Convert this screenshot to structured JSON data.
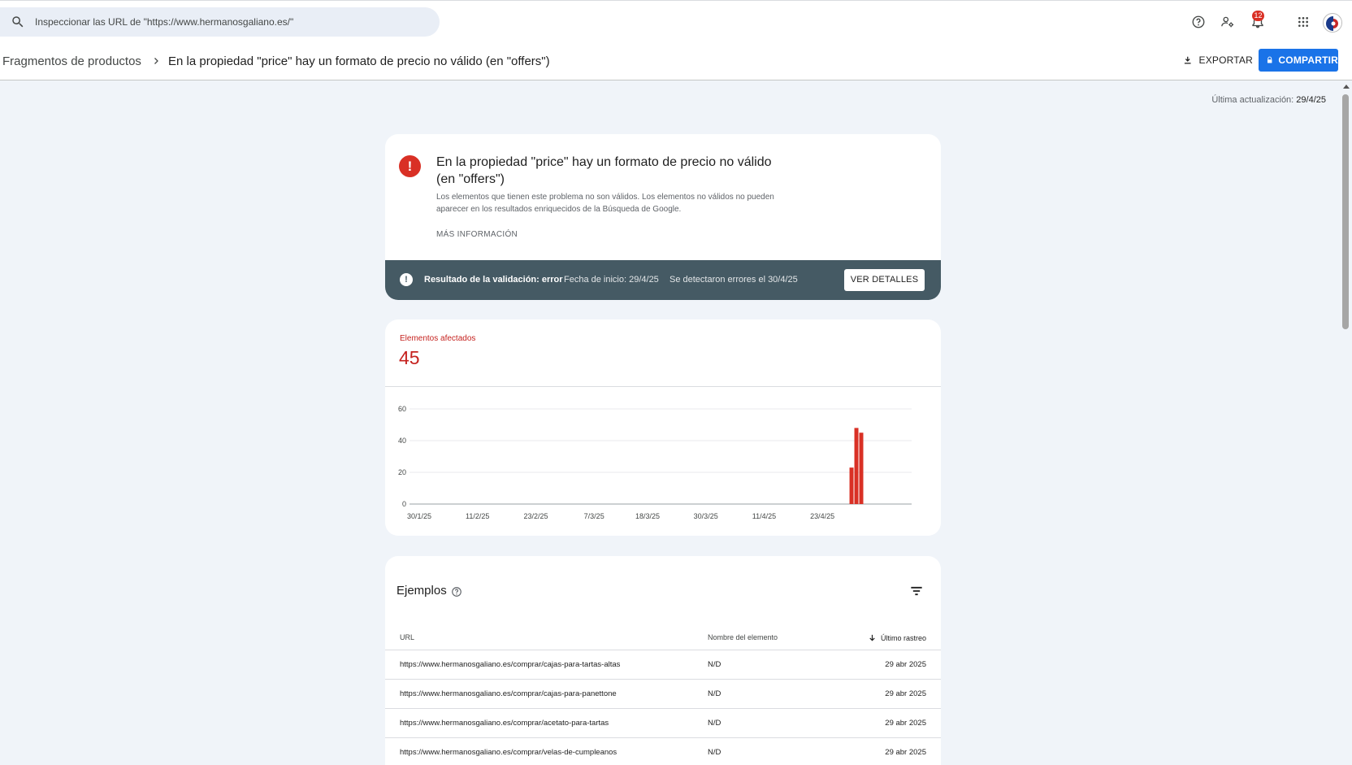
{
  "search": {
    "placeholder": "Inspeccionar las URL de \"https://www.hermanosgaliano.es/\""
  },
  "topbar": {
    "notifications_count": "12",
    "icons": [
      "help-icon",
      "manage-users-icon",
      "notifications-icon",
      "apps-icon",
      "account-avatar"
    ]
  },
  "header": {
    "breadcrumb": "Fragmentos de productos",
    "title": "En la propiedad \"price\" hay un formato de precio no válido (en \"offers\")",
    "export_label": "EXPORTAR",
    "share_label": "COMPARTIR"
  },
  "updated": {
    "label": "Última actualización:",
    "date": "29/4/25"
  },
  "issue": {
    "title": "En la propiedad \"price\" hay un formato de precio no válido (en \"offers\")",
    "description": "Los elementos que tienen este problema no son válidos. Los elementos no válidos no pueden aparecer en los resultados enriquecidos de la Búsqueda de Google.",
    "more_info": "MÁS INFORMACIÓN"
  },
  "validation": {
    "result": "Resultado de la validación: error",
    "start_date": "Fecha de inicio: 29/4/25",
    "errors_detected": "Se detectaron errores el 30/4/25",
    "details_button": "VER DETALLES"
  },
  "affected": {
    "label": "Elementos afectados",
    "count": "45"
  },
  "chart_data": {
    "type": "bar",
    "x_tick_labels": [
      "30/1/25",
      "11/2/25",
      "23/2/25",
      "7/3/25",
      "18/3/25",
      "30/3/25",
      "11/4/25",
      "23/4/25"
    ],
    "y_ticks": [
      0,
      20,
      40,
      60
    ],
    "ylim": [
      0,
      60
    ],
    "x_start": "30/1/25",
    "x_end": "30/4/25",
    "points": [
      {
        "x": "28/4/25",
        "y": 23
      },
      {
        "x": "29/4/25",
        "y": 48
      },
      {
        "x": "30/4/25",
        "y": 45
      }
    ],
    "bar_color": "#d93025",
    "grid": true
  },
  "examples": {
    "title": "Ejemplos",
    "columns": {
      "url": "URL",
      "name": "Nombre del elemento",
      "crawl": "Último rastreo"
    },
    "rows": [
      {
        "url": "https://www.hermanosgaliano.es/comprar/cajas-para-tartas-altas",
        "name": "N/D",
        "date": "29 abr 2025"
      },
      {
        "url": "https://www.hermanosgaliano.es/comprar/cajas-para-panettone",
        "name": "N/D",
        "date": "29 abr 2025"
      },
      {
        "url": "https://www.hermanosgaliano.es/comprar/acetato-para-tartas",
        "name": "N/D",
        "date": "29 abr 2025"
      },
      {
        "url": "https://www.hermanosgaliano.es/comprar/velas-de-cumpleanos",
        "name": "N/D",
        "date": "29 abr 2025"
      }
    ]
  }
}
